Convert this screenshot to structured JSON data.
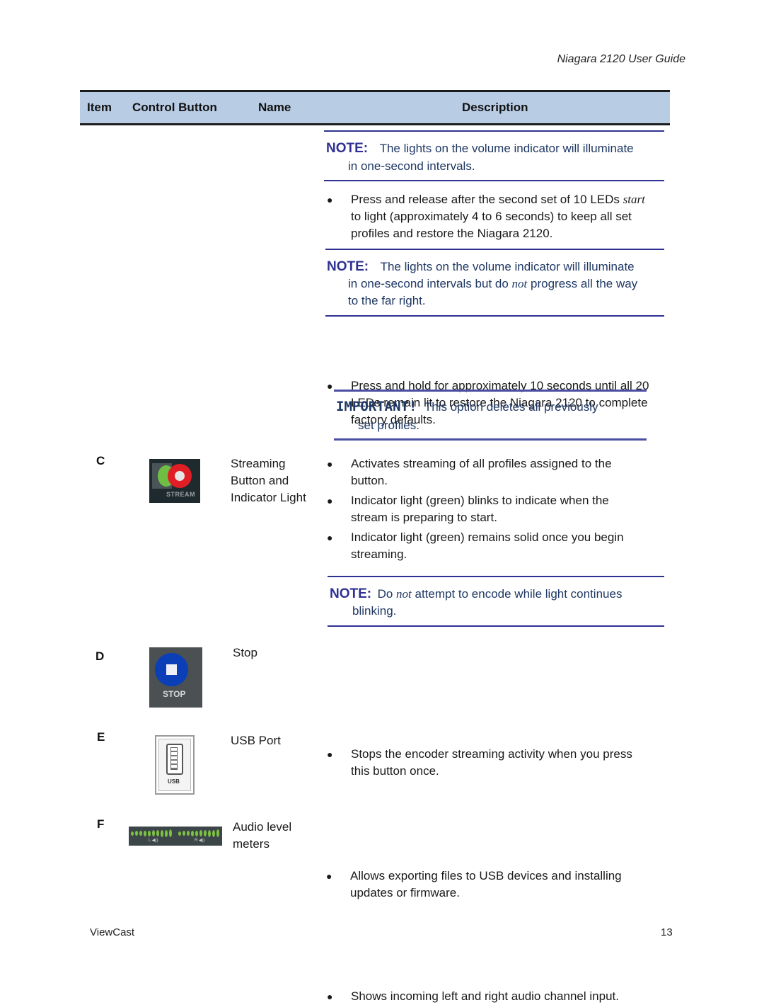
{
  "header": {
    "title": "Niagara 2120 User Guide"
  },
  "table": {
    "columns": [
      "Item",
      "Control Button",
      "Name",
      "Description"
    ]
  },
  "continued": {
    "note1": {
      "label": "NOTE:",
      "text_line1": "The lights on the volume indicator will illuminate",
      "text_line2": "in one-second intervals."
    },
    "bullet1": {
      "line1_pre": "Press and release after the second set of 10 LEDs ",
      "line1_italic": "start",
      "line2": "to light (approximately 4 to 6 seconds) to keep all set",
      "line3": "profiles and restore the Niagara 2120."
    },
    "note2": {
      "label": "NOTE:",
      "text_line1": "The lights on the volume indicator will illuminate",
      "text_line2_pre": "in one-second intervals but do ",
      "text_line2_italic": "not",
      "text_line2_post": " progress all the way",
      "text_line3": "to the far right."
    },
    "bullet2": {
      "line1": "Press and hold for approximately 10 seconds until all 20",
      "line2": "LEDs remain lit to restore the Niagara 2120 to complete",
      "line3": "factory defaults."
    },
    "important": {
      "label": "IMPORTANT!",
      "text_line1": "This option  deletes all previously",
      "text_line2": "set profiles."
    }
  },
  "rows": [
    {
      "item": "C",
      "button_caption": "STREAM",
      "icon": "stream-button-icon",
      "name_lines": [
        "Streaming",
        "Button and",
        "Indicator Light"
      ],
      "bullets": [
        [
          "Activates streaming of all profiles assigned to the",
          "button."
        ],
        [
          "Indicator light (green) blinks to indicate when the",
          "stream is preparing to start."
        ],
        [
          "Indicator light (green) remains solid once you begin",
          "streaming."
        ]
      ],
      "note": {
        "label": "NOTE:",
        "pre": "Do ",
        "italic": "not",
        "post": " attempt to encode while light continues",
        "line2": "blinking."
      }
    },
    {
      "item": "D",
      "button_caption": "STOP",
      "icon": "stop-button-icon",
      "name_lines": [
        "Stop"
      ],
      "bullets": [
        [
          "Stops the encoder streaming activity when you press",
          "this button once."
        ]
      ]
    },
    {
      "item": "E",
      "button_caption": "USB",
      "icon": "usb-port-icon",
      "name_lines": [
        "USB Port"
      ],
      "bullets": [
        [
          "Allows exporting files to USB devices and installing",
          "updates or firmware."
        ]
      ]
    },
    {
      "item": "F",
      "button_caption_left": "L",
      "button_caption_right": "R",
      "icon": "audio-meter-icon",
      "name_lines": [
        "Audio level",
        "meters"
      ],
      "bullets": [
        [
          "Shows incoming left and right audio channel input."
        ]
      ]
    }
  ],
  "footer": {
    "left": "ViewCast",
    "page_number": "13"
  },
  "colors": {
    "header_fill": "#b8cce4",
    "note_blue": "#2e3192",
    "note_text": "#1f3864",
    "led_green": "#7dc242",
    "stream_red": "#e01e25",
    "stop_blue": "#0a3fb8"
  }
}
